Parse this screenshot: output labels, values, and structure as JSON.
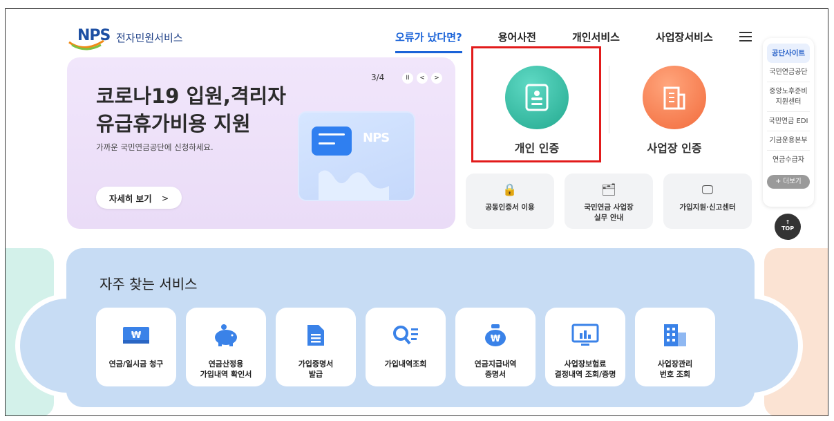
{
  "header": {
    "logo_text": "NPS",
    "service_name": "전자민원서비스",
    "nav": [
      "오류가 났다면?",
      "용어사전",
      "개인서비스",
      "사업장서비스"
    ]
  },
  "hero": {
    "title": "코로나19 입원,격리자\n유급휴가비용 지원",
    "subtitle": "가까운 국민연금공단에 신청하세요.",
    "button": "자세히 보기",
    "page": "3/4",
    "card_logo": "NPS"
  },
  "auth": {
    "personal": "개인 인증",
    "company": "사업장 인증"
  },
  "quick_services": [
    {
      "label": "공동인증서 이용",
      "icon": "lock-icon"
    },
    {
      "label": "국민연금 사업장\n실무 안내",
      "icon": "document-icon"
    },
    {
      "label": "가입지원·신고센터",
      "icon": "monitor-star-icon"
    }
  ],
  "side_panel": {
    "header": "공단사이트",
    "items": [
      "국민연금공단",
      "중앙노후준비\n지원센터",
      "국민연금 EDI",
      "기금운용본부",
      "연금수급자"
    ],
    "more": "+ 더보기",
    "top": "TOP"
  },
  "frequent": {
    "title": "자주 찾는 서비스",
    "items": [
      {
        "label": "연금/일시금 청구",
        "icon": "won-card-icon"
      },
      {
        "label": "연금산정용\n가입내역 확인서",
        "icon": "piggy-bank-icon"
      },
      {
        "label": "가입증명서\n발급",
        "icon": "certificate-icon"
      },
      {
        "label": "가입내역조회",
        "icon": "search-list-icon"
      },
      {
        "label": "연금지급내역\n증명서",
        "icon": "money-bag-icon"
      },
      {
        "label": "사업장보험료\n결정내역 조회/증명",
        "icon": "chart-monitor-icon"
      },
      {
        "label": "사업장관리\n번호 조회",
        "icon": "building-icon"
      }
    ]
  },
  "colors": {
    "accent": "#1a63d8",
    "highlight_border": "#e21b1b",
    "personal": "#23a98f",
    "company": "#f26b3c",
    "band": "#c7dcf4"
  }
}
